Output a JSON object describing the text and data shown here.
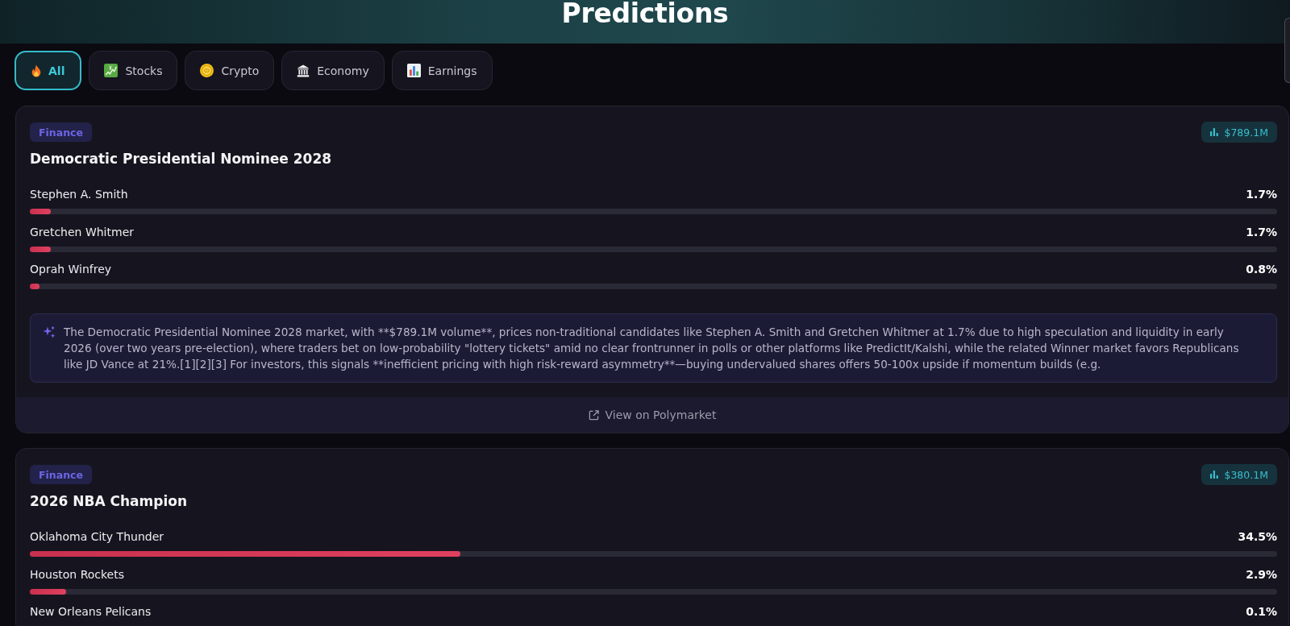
{
  "header": {
    "title": "Predictions"
  },
  "tabs": [
    {
      "label": "All",
      "selected": true
    },
    {
      "label": "Stocks",
      "selected": false
    },
    {
      "label": "Crypto",
      "selected": false
    },
    {
      "label": "Economy",
      "selected": false
    },
    {
      "label": "Earnings",
      "selected": false
    }
  ],
  "markets": [
    {
      "category": "Finance",
      "volume": "$789.1M",
      "title": "Democratic Presidential Nominee 2028",
      "outcomes": [
        {
          "name": "Stephen A. Smith",
          "percent": "1.7%",
          "level": 0.017
        },
        {
          "name": "Gretchen Whitmer",
          "percent": "1.7%",
          "level": 0.017
        },
        {
          "name": "Oprah Winfrey",
          "percent": "0.8%",
          "level": 0.008
        }
      ],
      "summary": "The Democratic Presidential Nominee 2028 market, with **$789.1M volume**, prices non-traditional candidates like Stephen A. Smith and Gretchen Whitmer at 1.7% due to high speculation and liquidity in early 2026 (over two years pre-election), where traders bet on low-probability \"lottery tickets\" amid no clear frontrunner in polls or other platforms like PredictIt/Kalshi, while the related Winner market favors Republicans like JD Vance at 21%.[1][2][3] For investors, this signals **inefficient pricing with high risk-reward asymmetry**—buying undervalued shares offers 50-100x upside if momentum builds (e.g.",
      "link": "View on Polymarket"
    },
    {
      "category": "Finance",
      "volume": "$380.1M",
      "title": "2026 NBA Champion",
      "outcomes": [
        {
          "name": "Oklahoma City Thunder",
          "percent": "34.5%",
          "level": 0.345
        },
        {
          "name": "Houston Rockets",
          "percent": "2.9%",
          "level": 0.029
        },
        {
          "name": "New Orleans Pelicans",
          "percent": "0.1%"
        }
      ]
    }
  ]
}
